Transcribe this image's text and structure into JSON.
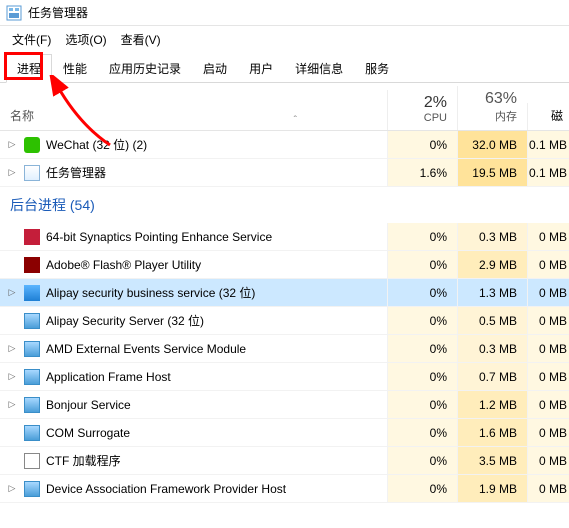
{
  "window": {
    "title": "任务管理器"
  },
  "menu": {
    "file": "文件(F)",
    "options": "选项(O)",
    "view": "查看(V)"
  },
  "tabs": {
    "processes": "进程",
    "performance": "性能",
    "app_history": "应用历史记录",
    "startup": "启动",
    "users": "用户",
    "details": "详细信息",
    "services": "服务"
  },
  "columns": {
    "name": "名称",
    "cpu": {
      "pct": "2%",
      "label": "CPU"
    },
    "mem": {
      "pct": "63%",
      "label": "内存"
    },
    "disk": {
      "pct": "",
      "label": "磁"
    }
  },
  "section": {
    "background": "后台进程 (54)"
  },
  "rows": [
    {
      "expand": true,
      "icon": "wechat",
      "name": "WeChat (32 位) (2)",
      "cpu": "0%",
      "mem": "32.0 MB",
      "disk": "0.1 MB"
    },
    {
      "expand": true,
      "icon": "taskmgr",
      "name": "任务管理器",
      "cpu": "1.6%",
      "mem": "19.5 MB",
      "disk": "0.1 MB",
      "cpuClass": "mem-vlow",
      "memClass": "mem-low"
    }
  ],
  "bgrows": [
    {
      "icon": "synaptics",
      "name": "64-bit Synaptics Pointing Enhance Service",
      "cpu": "0%",
      "mem": "0.3 MB",
      "disk": "0 MB"
    },
    {
      "icon": "flash",
      "name": "Adobe® Flash® Player Utility",
      "cpu": "0%",
      "mem": "2.9 MB",
      "disk": "0 MB"
    },
    {
      "expand": true,
      "selected": true,
      "icon": "alipay1",
      "name": "Alipay security business service (32 位)",
      "cpu": "0%",
      "mem": "1.3 MB",
      "disk": "0 MB"
    },
    {
      "icon": "service",
      "name": "Alipay Security Server (32 位)",
      "cpu": "0%",
      "mem": "0.5 MB",
      "disk": "0 MB"
    },
    {
      "expand": true,
      "icon": "service",
      "name": "AMD External Events Service Module",
      "cpu": "0%",
      "mem": "0.3 MB",
      "disk": "0 MB"
    },
    {
      "expand": true,
      "icon": "service",
      "name": "Application Frame Host",
      "cpu": "0%",
      "mem": "0.7 MB",
      "disk": "0 MB"
    },
    {
      "expand": true,
      "icon": "service",
      "name": "Bonjour Service",
      "cpu": "0%",
      "mem": "1.2 MB",
      "disk": "0 MB"
    },
    {
      "icon": "service",
      "name": "COM Surrogate",
      "cpu": "0%",
      "mem": "1.6 MB",
      "disk": "0 MB"
    },
    {
      "icon": "ctf",
      "name": "CTF 加载程序",
      "cpu": "0%",
      "mem": "3.5 MB",
      "disk": "0 MB"
    },
    {
      "expand": true,
      "icon": "service",
      "name": "Device Association Framework Provider Host",
      "cpu": "0%",
      "mem": "1.9 MB",
      "disk": "0 MB"
    }
  ]
}
